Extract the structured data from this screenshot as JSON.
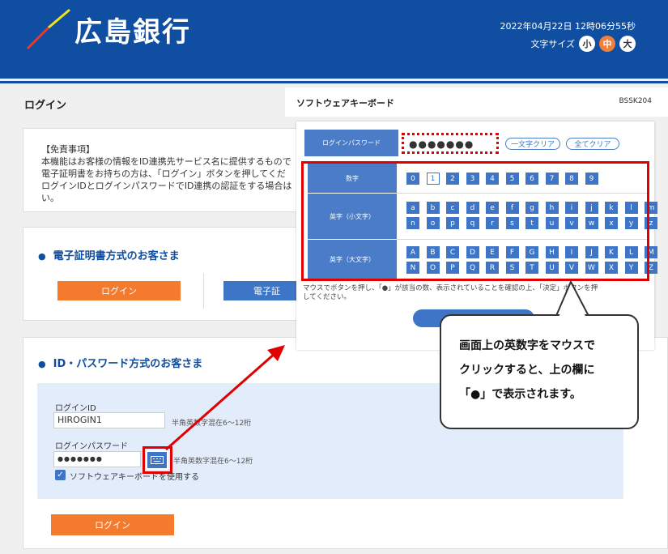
{
  "header": {
    "logo_text": "広島銀行",
    "datetime": "2022年04月22日 12時06分55秒",
    "fontsize_label": "文字サイズ",
    "fontsize_small": "小",
    "fontsize_medium": "中",
    "fontsize_large": "大"
  },
  "page_title": "ログイン",
  "disclaimer": {
    "title": "【免責事項】",
    "lines": [
      "本機能はお客様の情報をID連携先サービス名に提供するもので",
      "電子証明書をお持ちの方は、「ログイン」ボタンを押してくだ",
      "ログインIDとログインパスワードでID連携の認証をする場合は",
      "い。"
    ]
  },
  "cert_section": {
    "title": "電子証明書方式のお客さま",
    "login_button": "ログイン",
    "cert_button": "電子証"
  },
  "id_section": {
    "title": "ID・パスワード方式のお客さま",
    "login_id_label": "ログインID",
    "login_id_value": "HIROGIN1",
    "login_id_hint": "半角英数字混在6～12桁",
    "password_label": "ログインパスワード",
    "password_value": "●●●●●●●",
    "password_hint": "半角英数字混在6～12桁",
    "software_keyboard_check": "ソフトウェアキーボードを使用する",
    "login_button": "ログイン"
  },
  "soft_keyboard": {
    "title": "ソフトウェアキーボード",
    "code": "BSSK204",
    "password_label": "ログインパスワード",
    "password_value": "●●●●●●●",
    "clear_one": "一文字クリア",
    "clear_all": "全てクリア",
    "digits_label": "数字",
    "lower_label": "英字（小文字）",
    "upper_label": "英字（大文字）",
    "digits": [
      "0",
      "1",
      "2",
      "3",
      "4",
      "5",
      "6",
      "7",
      "8",
      "9"
    ],
    "selected_digit": "1",
    "lower_row1": [
      "a",
      "b",
      "c",
      "d",
      "e",
      "f",
      "g",
      "h",
      "i",
      "j",
      "k",
      "l",
      "m"
    ],
    "lower_row2": [
      "n",
      "o",
      "p",
      "q",
      "r",
      "s",
      "t",
      "u",
      "v",
      "w",
      "x",
      "y",
      "z"
    ],
    "upper_row1": [
      "A",
      "B",
      "C",
      "D",
      "E",
      "F",
      "G",
      "H",
      "I",
      "J",
      "K",
      "L",
      "M"
    ],
    "upper_row2": [
      "N",
      "O",
      "P",
      "Q",
      "R",
      "S",
      "T",
      "U",
      "V",
      "W",
      "X",
      "Y",
      "Z"
    ],
    "instruction_line1": "マウスでボタンを押し、「●」が該当の数、表示されていることを確認の上、「決定」ボタンを押",
    "instruction_line2": "してください。"
  },
  "callout": {
    "line1": "画面上の英数字をマウスで",
    "line2": "クリックすると、上の欄に",
    "line3": "「●」で表示されます。"
  },
  "colors": {
    "brand_blue": "#0f4ea0",
    "button_blue": "#3e75c6",
    "button_orange": "#f47a2e",
    "highlight_red": "#e00000"
  }
}
